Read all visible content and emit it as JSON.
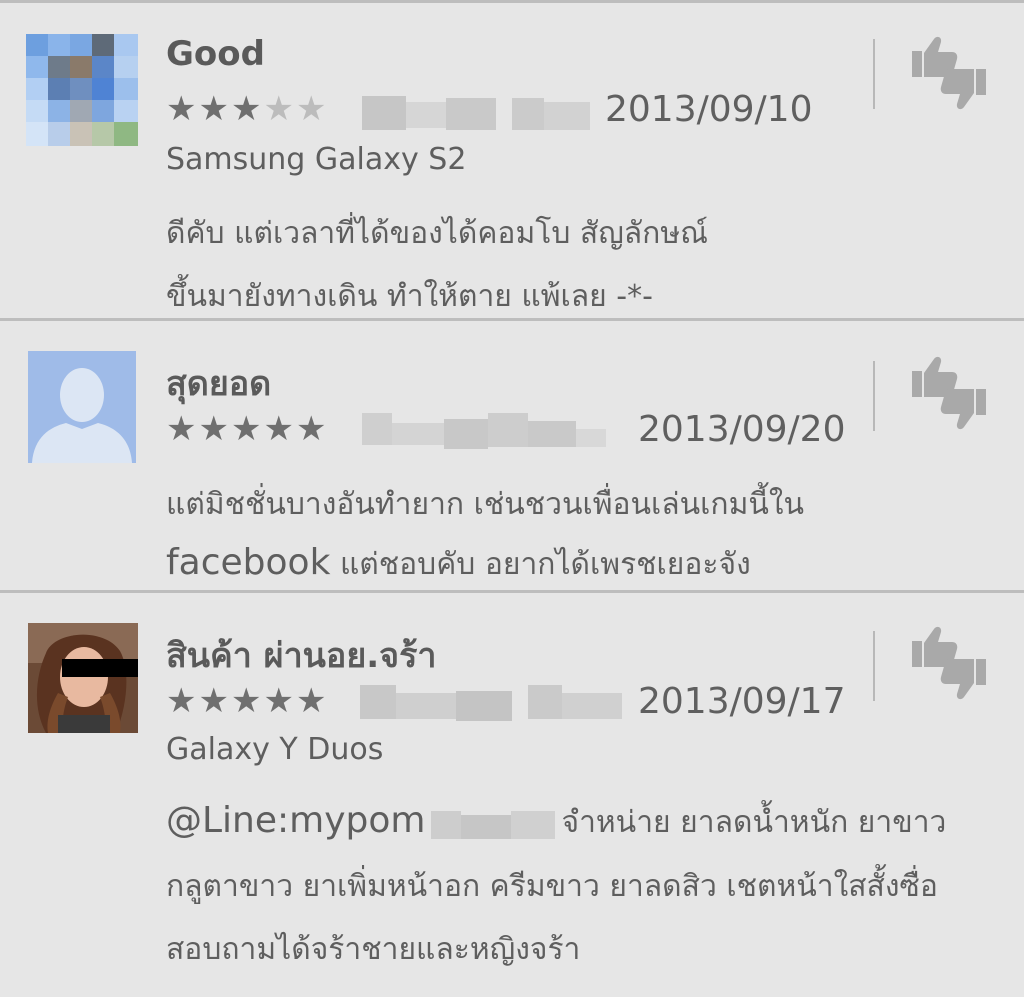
{
  "reviews": [
    {
      "title": "Good",
      "stars_filled": 3,
      "stars_total": 5,
      "date": "2013/09/10",
      "device": "Samsung Galaxy S2",
      "body_lines": [
        "ดีคับ แต่เวลาที่ได้ของได้คอมโบ สัญลักษณ์",
        "ขึ้นมายังทางเดิน ทำให้ตาย แพ้เลย -*-"
      ],
      "avatar": "pixelated-photo",
      "star_glyph_on": "★",
      "star_glyph_off": "★"
    },
    {
      "title": "สุดยอด",
      "stars_filled": 5,
      "stars_total": 5,
      "date": "2013/09/20",
      "device": "",
      "body_line_1": "แต่มิชชั่นบางอันทำยาก  เช่นชวนเพื่อนเล่นเกมนี้ใน",
      "body_line_2_a": "facebook",
      "body_line_2_b": " แต่ชอบคับ  อยากได้เพรชเยอะจัง",
      "avatar": "default-person-silhouette"
    },
    {
      "title": "สินค้า ผ่านอย.จร้า",
      "stars_filled": 5,
      "stars_total": 5,
      "date": "2013/09/17",
      "device": "Galaxy Y Duos",
      "body_line_1_a": "@Line:mypom",
      "body_line_1_b": "จำหน่าย ยาลดน้ำหนัก ยาขาว",
      "body_line_2": "กลูตาขาว ยาเพิ่มหน้าอก ครีมขาว ยาลดสิว เชตหน้าใสสั้งซื่อ",
      "body_line_3": "สอบถามได้จร้าชายและหญิงจร้า",
      "avatar": "user-photo-with-censor-bar"
    }
  ],
  "colors": {
    "background": "#e6e6e6",
    "divider": "#bdbdbd",
    "text": "#5e5e5e",
    "star_on": "#6f6f6f",
    "star_off": "#bcbcbc",
    "thumb_icon": "#a9a9a9"
  },
  "icons": {
    "rate_review": "thumbs-up-down-icon"
  }
}
